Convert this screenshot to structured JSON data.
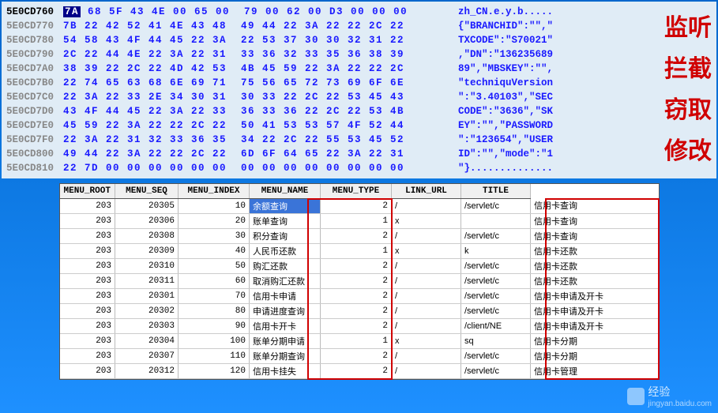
{
  "hex": {
    "rows": [
      {
        "offset": "5E0CD760",
        "bytes_pre": "",
        "hi": "7A",
        "bytes_post": " 68 5F 43 4E 00 65 00  79 00 62 00 D3 00 00 00",
        "ascii": "zh_CN.e.y.b....."
      },
      {
        "offset": "5E0CD770",
        "bytes": "7B 22 42 52 41 4E 43 48  49 44 22 3A 22 22 2C 22",
        "ascii": "{\"BRANCHID\":\"\",\""
      },
      {
        "offset": "5E0CD780",
        "bytes": "54 58 43 4F 44 45 22 3A  22 53 37 30 30 32 31 22",
        "ascii": "TXCODE\":\"S70021\""
      },
      {
        "offset": "5E0CD790",
        "bytes": "2C 22 44 4E 22 3A 22 31  33 36 32 33 35 36 38 39",
        "ascii": ",\"DN\":\"136235689"
      },
      {
        "offset": "5E0CD7A0",
        "bytes": "38 39 22 2C 22 4D 42 53  4B 45 59 22 3A 22 22 2C",
        "ascii": "89\",\"MBSKEY\":\"\","
      },
      {
        "offset": "5E0CD7B0",
        "bytes": "22 74 65 63 68 6E 69 71  75 56 65 72 73 69 6F 6E",
        "ascii": "\"techniquVersion"
      },
      {
        "offset": "5E0CD7C0",
        "bytes": "22 3A 22 33 2E 34 30 31  30 33 22 2C 22 53 45 43",
        "ascii": "\":\"3.40103\",\"SEC"
      },
      {
        "offset": "5E0CD7D0",
        "bytes": "43 4F 44 45 22 3A 22 33  36 33 36 22 2C 22 53 4B",
        "ascii": "CODE\":\"3636\",\"SK"
      },
      {
        "offset": "5E0CD7E0",
        "bytes": "45 59 22 3A 22 22 2C 22  50 41 53 53 57 4F 52 44",
        "ascii": "EY\":\"\",\"PASSWORD"
      },
      {
        "offset": "5E0CD7F0",
        "bytes": "22 3A 22 31 32 33 36 35  34 22 2C 22 55 53 45 52",
        "ascii": "\":\"123654\",\"USER"
      },
      {
        "offset": "5E0CD800",
        "bytes": "49 44 22 3A 22 22 2C 22  6D 6F 64 65 22 3A 22 31",
        "ascii": "ID\":\"\",\"mode\":\"1"
      },
      {
        "offset": "5E0CD810",
        "bytes": "22 7D 00 00 00 00 00 00  00 00 00 00 00 00 00 00",
        "ascii": "\"}.............."
      }
    ]
  },
  "overlay": [
    "监听",
    "拦截",
    "窃取",
    "修改"
  ],
  "table": {
    "headers": [
      "MENU_ROOT",
      "MENU_SEQ",
      "MENU_INDEX",
      "MENU_NAME",
      "MENU_TYPE",
      "LINK_URL",
      "TITLE"
    ],
    "rows": [
      {
        "root": "203",
        "seq": "20305",
        "idx": "10",
        "name": "余额查询",
        "type": "2",
        "url": "/",
        "link": "/servlet/c",
        "title": "信用卡查询",
        "sel": true
      },
      {
        "root": "203",
        "seq": "20306",
        "idx": "20",
        "name": "账单查询",
        "type": "1",
        "url": "x",
        "link": "",
        "title": "信用卡查询"
      },
      {
        "root": "203",
        "seq": "20308",
        "idx": "30",
        "name": "积分查询",
        "type": "2",
        "url": "/",
        "link": "/servlet/c",
        "title": "信用卡查询"
      },
      {
        "root": "203",
        "seq": "20309",
        "idx": "40",
        "name": "人民币还款",
        "type": "1",
        "url": "x",
        "link": "k",
        "title": "信用卡还款"
      },
      {
        "root": "203",
        "seq": "20310",
        "idx": "50",
        "name": "购汇还款",
        "type": "2",
        "url": "/",
        "link": "/servlet/c",
        "title": "信用卡还款"
      },
      {
        "root": "203",
        "seq": "20311",
        "idx": "60",
        "name": "取消购汇还款",
        "type": "2",
        "url": "/",
        "link": "/servlet/c",
        "title": "信用卡还款"
      },
      {
        "root": "203",
        "seq": "20301",
        "idx": "70",
        "name": "信用卡申请",
        "type": "2",
        "url": "/",
        "link": "/servlet/c",
        "title": "信用卡申请及开卡"
      },
      {
        "root": "203",
        "seq": "20302",
        "idx": "80",
        "name": "申请进度查询",
        "type": "2",
        "url": "/",
        "link": "/servlet/c",
        "title": "信用卡申请及开卡"
      },
      {
        "root": "203",
        "seq": "20303",
        "idx": "90",
        "name": "信用卡开卡",
        "type": "2",
        "url": "/",
        "link": "/client/NE",
        "title": "信用卡申请及开卡"
      },
      {
        "root": "203",
        "seq": "20304",
        "idx": "100",
        "name": "账单分期申请",
        "type": "1",
        "url": "x",
        "link": "sq",
        "title": "信用卡分期"
      },
      {
        "root": "203",
        "seq": "20307",
        "idx": "110",
        "name": "账单分期查询",
        "type": "2",
        "url": "/",
        "link": "/servlet/c",
        "title": "信用卡分期"
      },
      {
        "root": "203",
        "seq": "20312",
        "idx": "120",
        "name": "信用卡挂失",
        "type": "2",
        "url": "/",
        "link": "/servlet/c",
        "title": "信用卡管理"
      }
    ]
  },
  "watermark": {
    "text": "经验",
    "sub": "jingyan.baidu.com"
  }
}
